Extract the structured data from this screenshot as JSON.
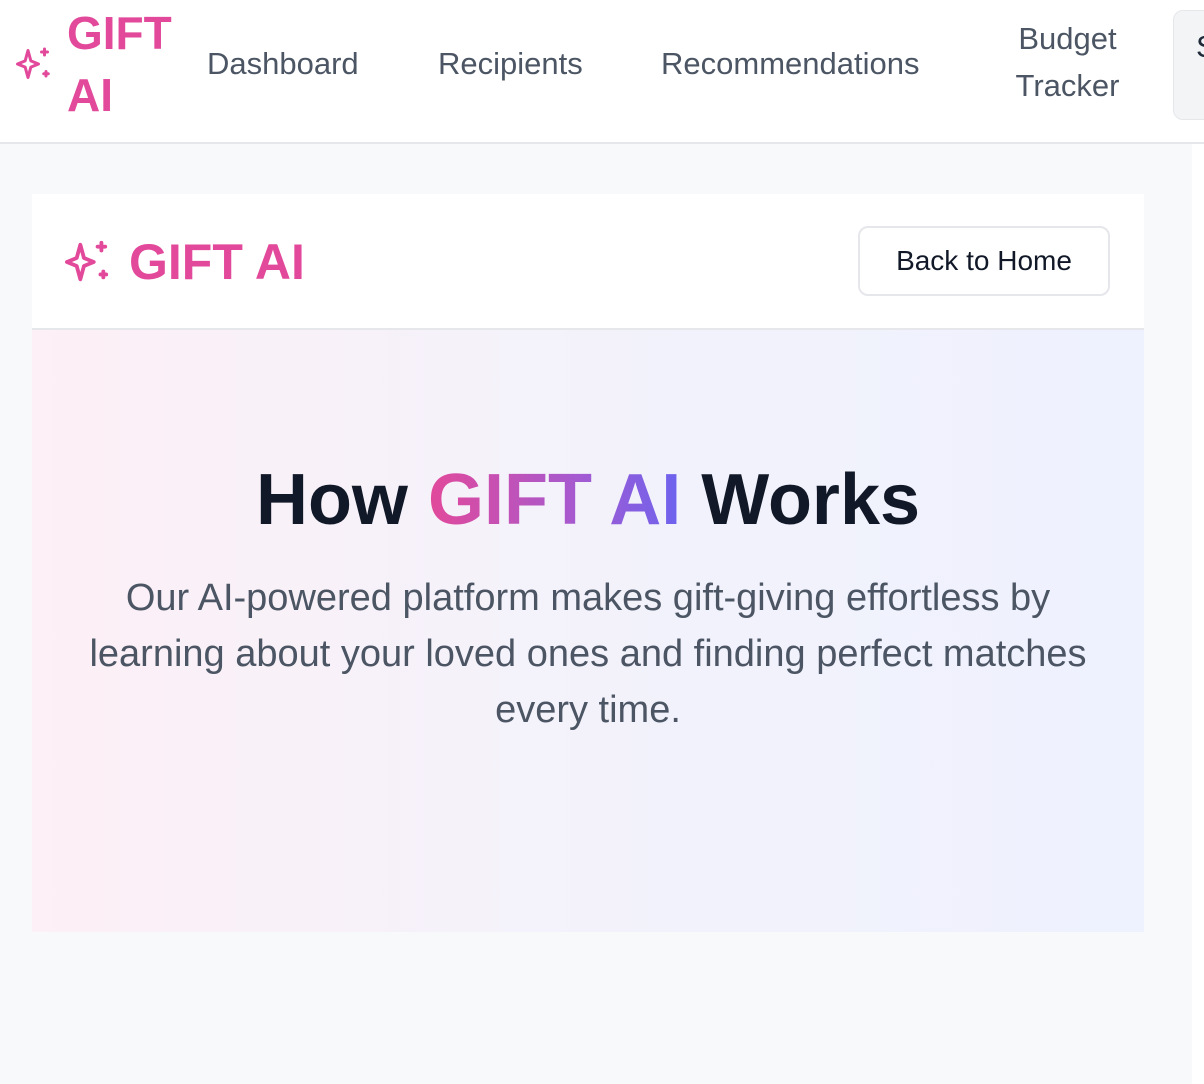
{
  "nav": {
    "brand": "GIFT AI",
    "links": [
      "Dashboard",
      "Recipients",
      "Recommendations",
      "Budget Tracker"
    ],
    "cutoff_label": "S"
  },
  "header": {
    "brand": "GIFT AI",
    "back_button": "Back to Home"
  },
  "hero": {
    "title_before": "How",
    "title_highlight": "GIFT AI",
    "title_after": "Works",
    "description": "Our AI-powered platform makes gift-giving effortless by learning about your loved ones and finding perfect matches every time."
  },
  "icons": {
    "brand": "sparkles-icon"
  },
  "colors": {
    "brand_pink": "#e2499a",
    "brand_indigo": "#6c63ee",
    "text_dark": "#111827",
    "text_muted": "#4b5563"
  }
}
